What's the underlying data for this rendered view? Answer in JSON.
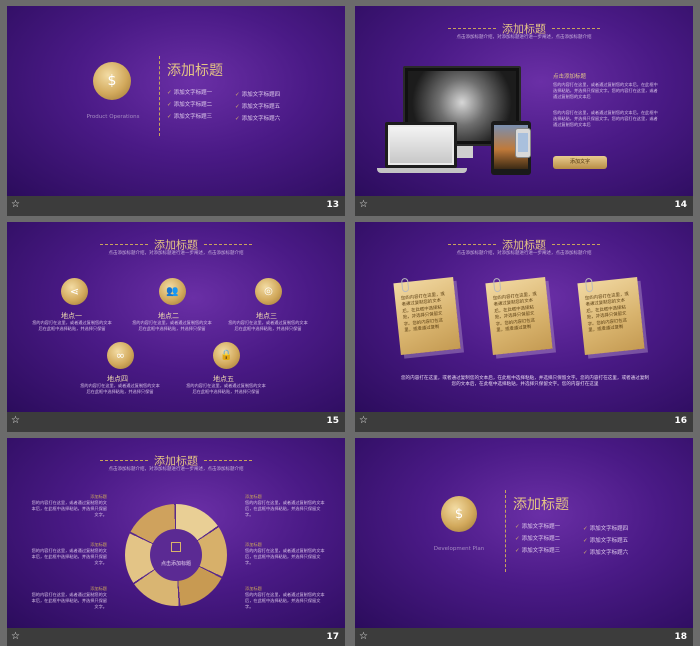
{
  "slides": {
    "s13": {
      "number": "13",
      "title": "添加标题",
      "caption": "Product Operations",
      "items_left": [
        "添加文字标题一",
        "添加文字标题二",
        "添加文字标题三"
      ],
      "items_right": [
        "添加文字标题四",
        "添加文字标题五",
        "添加文字标题六"
      ]
    },
    "s14": {
      "number": "14",
      "title": "添加标题",
      "subtitle": "点击添加标题介绍，对添加标题进行进一步阐述，点击添加标题介绍",
      "side_title": "点击添加标题",
      "para1": "您的内容打在这里，或者通过复制您的文本后，在此框中选择粘贴，并选择只保留文字。您的内容打在这里，或者通过复制您的文本后",
      "para2": "您的内容打在这里，或者通过复制您的文本后，在此框中选择粘贴，并选择只保留文字。您的内容打在这里，或者通过复制您的文本后",
      "button": "添加文字"
    },
    "s15": {
      "number": "15",
      "title": "添加标题",
      "subtitle": "点击添加标题介绍，对添加标题进行进一步阐述，点击添加标题介绍",
      "places": [
        {
          "label": "地点一",
          "icon": "share-icon",
          "text": "您的内容打在这里，或者通过复制您的文本后在此框中选择粘贴，并选择只保留"
        },
        {
          "label": "地点二",
          "icon": "users-icon",
          "text": "您的内容打在这里，或者通过复制您的文本后在此框中选择粘贴，并选择只保留"
        },
        {
          "label": "地点三",
          "icon": "coin-icon",
          "text": "您的内容打在这里，或者通过复制您的文本后在此框中选择粘贴，并选择只保留"
        },
        {
          "label": "地点四",
          "icon": "link-icon",
          "text": "您的内容打在这里，或者通过复制您的文本后在此框中选择粘贴，并选择只保留"
        },
        {
          "label": "地点五",
          "icon": "lock-icon",
          "text": "您的内容打在这里，或者通过复制您的文本后在此框中选择粘贴，并选择只保留"
        }
      ]
    },
    "s16": {
      "number": "16",
      "title": "添加标题",
      "subtitle": "点击添加标题介绍，对添加标题进行进一步阐述，点击添加标题介绍",
      "notes": [
        "您的内容打在这里，或者通过复制您的文本后，在此框中选择粘贴，并选择只保留文字。您的内容打在这里，或者通过复制",
        "您的内容打在这里，或者通过复制您的文本后，在此框中选择粘贴，并选择只保留文字。您的内容打在这里，或者通过复制",
        "您的内容打在这里，或者通过复制您的文本后，在此框中选择粘贴，并选择只保留文字。您的内容打在这里，或者通过复制"
      ],
      "footer": "您的内容打在这里，或者通过复制您的文本后，在此框中选择粘贴，并选择只保留文字。您的内容打在这里，或者通过复制您的文本后，在此框中选择粘贴，并选择只保留文字。您的内容打在这里"
    },
    "s17": {
      "number": "17",
      "title": "添加标题",
      "subtitle": "点击添加标题介绍，对添加标题进行进一步阐述，点击添加标题介绍",
      "center": "点击添加标题",
      "blocks_left": [
        {
          "head": "添加标题",
          "text": "您的内容打在这里，或者通过复制您的文本后，在此框中选择粘贴，并选择只保留文字。"
        },
        {
          "head": "添加标题",
          "text": "您的内容打在这里，或者通过复制您的文本后，在此框中选择粘贴，并选择只保留文字。"
        },
        {
          "head": "添加标题",
          "text": "您的内容打在这里，或者通过复制您的文本后，在此框中选择粘贴，并选择只保留文字。"
        }
      ],
      "blocks_right": [
        {
          "head": "添加标题",
          "text": "您的内容打在这里，或者通过复制您的文本后，在此框中选择粘贴，并选择只保留文字。"
        },
        {
          "head": "添加标题",
          "text": "您的内容打在这里，或者通过复制您的文本后，在此框中选择粘贴，并选择只保留文字。"
        },
        {
          "head": "添加标题",
          "text": "您的内容打在这里，或者通过复制您的文本后，在此框中选择粘贴，并选择只保留文字。"
        }
      ]
    },
    "s18": {
      "number": "18",
      "title": "添加标题",
      "caption": "Development Plan",
      "items_left": [
        "添加文字标题一",
        "添加文字标题二",
        "添加文字标题三"
      ],
      "items_right": [
        "添加文字标题四",
        "添加文字标题五",
        "添加文字标题六"
      ]
    }
  },
  "colors": {
    "gold": "#d9b46a",
    "purple": "#4a1a86",
    "bar": "#3c3c3c"
  }
}
